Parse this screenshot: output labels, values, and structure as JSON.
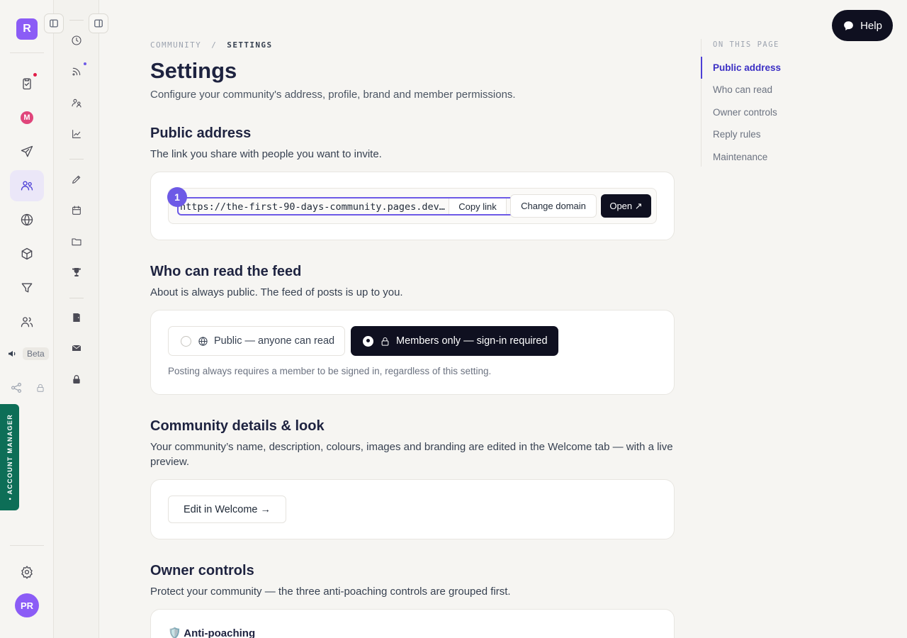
{
  "app": {
    "logo_letter": "R",
    "user_initials": "PR",
    "beta_label": "Beta",
    "account_manager_label": "• ACCOUNT MANAGER",
    "help_label": "Help"
  },
  "breadcrumb": {
    "parent": "COMMUNITY",
    "separator": "/",
    "current": "SETTINGS"
  },
  "page": {
    "title": "Settings",
    "subtitle": "Configure your community's address, profile, brand and member permissions."
  },
  "public_address": {
    "title": "Public address",
    "subtitle": "The link you share with people you want to invite.",
    "step_number": "1",
    "url": "https://the-first-90-days-community.pages.dev…",
    "copy_label": "Copy link",
    "change_label": "Change domain",
    "open_label": "Open ↗"
  },
  "feed_access": {
    "title": "Who can read the feed",
    "subtitle": "About is always public. The feed of posts is up to you.",
    "option_public": "Public — anyone can read",
    "option_members": "Members only — sign-in required",
    "selected": "members",
    "note": "Posting always requires a member to be signed in, regardless of this setting."
  },
  "details": {
    "title": "Community details & look",
    "subtitle": "Your community’s name, description, colours, images and branding are edited in the Welcome tab — with a live preview.",
    "edit_label": "Edit in Welcome →"
  },
  "owner_controls": {
    "title": "Owner controls",
    "subtitle": "Protect your community — the three anti-poaching controls are grouped first.",
    "anti_poaching_title": "🛡️ Anti-poaching"
  },
  "toc": {
    "heading": "ON THIS PAGE",
    "items": [
      "Public address",
      "Who can read",
      "Owner controls",
      "Reply rules",
      "Maintenance"
    ],
    "active": "Public address"
  },
  "colors": {
    "accent": "#4c3fd6",
    "brand": "#8b5cf6",
    "dark_button": "#0f1020",
    "account_tab": "#0d6e57"
  },
  "icons": {
    "primary_rail": [
      "clipboard-check-icon",
      "m-app-icon",
      "send-icon",
      "community-icon",
      "globe-icon",
      "box-icon",
      "funnel-icon",
      "users-icon",
      "megaphone-icon",
      "share-icon",
      "lock-icon",
      "gear-icon"
    ],
    "secondary_rail": [
      "clock-icon",
      "rss-icon",
      "members-icon",
      "chart-icon",
      "pen-icon",
      "calendar-icon",
      "folder-icon",
      "trophy-icon",
      "door-icon",
      "mail-icon",
      "lock-icon"
    ]
  }
}
